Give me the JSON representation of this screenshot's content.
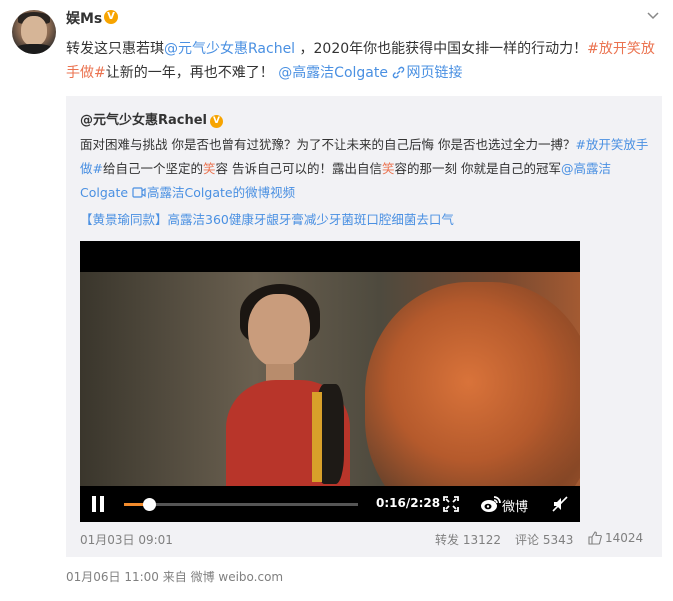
{
  "post": {
    "username": "娱Ms",
    "verified_badge": "V",
    "text_parts": [
      "转发这只惠若琪",
      "@元气少女惠Rachel",
      " ，2020年你也能获得中国女排一样的行动力！",
      "#放开笑放手做#",
      "让新的一年，再也不难了！ ",
      "@高露洁Colgate",
      " ",
      "网页链接"
    ],
    "footer": "01月06日 11:00  来自 微博 weibo.com"
  },
  "repost": {
    "username": "@元气少女惠Rachel",
    "verified_badge": "V",
    "text_parts": [
      "面对困难与挑战 你是否也曾有过犹豫？为了不让未来的自己后悔 你是否也选过全力一搏？",
      "#放开笑放手做#",
      "给自己一个坚定的",
      "笑",
      "容 告诉自己可以的！露出自信",
      "笑",
      "容的那一刻 你就是自己的冠军",
      "@高露洁Colgate",
      " ",
      "高露洁Colgate的微博视频"
    ],
    "ad_link": "【黄景瑜同款】高露洁360健康牙龈牙膏减少牙菌斑口腔细菌去口气",
    "date": "01月03日 09:01",
    "forward": "转发 13122",
    "comment": "评论 5343",
    "likes": "14024"
  },
  "video": {
    "time": "0:16/2:28",
    "progress": 0.108,
    "brand": "微博",
    "accent_color": "#f28b2c"
  },
  "colors": {
    "link": "#4a90e2",
    "topic": "#eb7350",
    "meta": "#808080",
    "repost_bg": "#f2f2f5"
  },
  "icons": [
    "chevron-down-icon",
    "link-icon",
    "video-link-icon",
    "pause-icon",
    "fullscreen-icon",
    "weibo-logo-icon",
    "mute-icon",
    "thumbs-up-icon"
  ]
}
